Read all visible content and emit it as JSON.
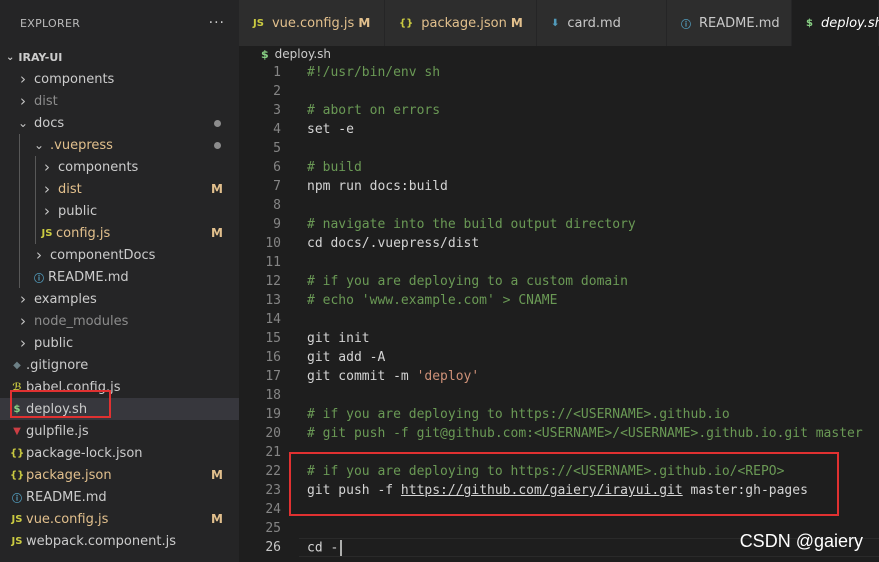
{
  "explorer": {
    "title": "EXPLORER",
    "more": "···",
    "root": "IRAY-UI",
    "items": [
      {
        "label": "components",
        "depth": 0,
        "type": "folder",
        "state": "collapsed"
      },
      {
        "label": "dist",
        "depth": 0,
        "type": "folder",
        "state": "collapsed",
        "dim": true
      },
      {
        "label": "docs",
        "depth": 0,
        "type": "folder",
        "state": "expanded",
        "dot": true
      },
      {
        "label": ".vuepress",
        "depth": 1,
        "type": "folder",
        "state": "expanded",
        "dot": true,
        "color": "#e2c08d"
      },
      {
        "label": "components",
        "depth": 2,
        "type": "folder",
        "state": "collapsed"
      },
      {
        "label": "dist",
        "depth": 2,
        "type": "folder",
        "state": "collapsed",
        "badge": "M",
        "color": "#e2c08d"
      },
      {
        "label": "public",
        "depth": 2,
        "type": "folder",
        "state": "collapsed"
      },
      {
        "label": "config.js",
        "depth": 2,
        "type": "file",
        "icon": "JS",
        "iconColor": "#cbcb41",
        "badge": "M",
        "color": "#e2c08d"
      },
      {
        "label": "componentDocs",
        "depth": 1,
        "type": "folder",
        "state": "collapsed"
      },
      {
        "label": "README.md",
        "depth": 1,
        "type": "file",
        "icon": "ⓘ",
        "iconColor": "#519aba"
      },
      {
        "label": "examples",
        "depth": 0,
        "type": "folder",
        "state": "collapsed"
      },
      {
        "label": "node_modules",
        "depth": 0,
        "type": "folder",
        "state": "collapsed",
        "dim": true
      },
      {
        "label": "public",
        "depth": 0,
        "type": "folder",
        "state": "collapsed"
      },
      {
        "label": ".gitignore",
        "depth": 0,
        "type": "file",
        "icon": "◆",
        "iconColor": "#6d8086"
      },
      {
        "label": "babel.config.js",
        "depth": 0,
        "type": "file",
        "icon": "ℬ",
        "iconColor": "#cbcb41"
      },
      {
        "label": "deploy.sh",
        "depth": 0,
        "type": "file",
        "icon": "$",
        "iconColor": "#89d185",
        "selected": true
      },
      {
        "label": "gulpfile.js",
        "depth": 0,
        "type": "file",
        "icon": "▼",
        "iconColor": "#cc3e44"
      },
      {
        "label": "package-lock.json",
        "depth": 0,
        "type": "file",
        "icon": "{}",
        "iconColor": "#cbcb41"
      },
      {
        "label": "package.json",
        "depth": 0,
        "type": "file",
        "icon": "{}",
        "iconColor": "#cbcb41",
        "badge": "M",
        "color": "#e2c08d"
      },
      {
        "label": "README.md",
        "depth": 0,
        "type": "file",
        "icon": "ⓘ",
        "iconColor": "#519aba"
      },
      {
        "label": "vue.config.js",
        "depth": 0,
        "type": "file",
        "icon": "JS",
        "iconColor": "#cbcb41",
        "badge": "M",
        "color": "#e2c08d"
      },
      {
        "label": "webpack.component.js",
        "depth": 0,
        "type": "file",
        "icon": "JS",
        "iconColor": "#cbcb41"
      }
    ]
  },
  "tabs": [
    {
      "label": "vue.config.js",
      "icon": "JS",
      "iconColor": "#cbcb41",
      "badge": "M",
      "color": "#e2c08d"
    },
    {
      "label": "package.json",
      "icon": "{}",
      "iconColor": "#cbcb41",
      "badge": "M",
      "color": "#e2c08d"
    },
    {
      "label": "card.md",
      "icon": "⬇",
      "iconColor": "#519aba"
    },
    {
      "label": "README.md",
      "icon": "ⓘ",
      "iconColor": "#519aba"
    },
    {
      "label": "deploy.sh",
      "icon": "$",
      "iconColor": "#89d185",
      "active": true
    }
  ],
  "breadcrumb": {
    "icon": "$",
    "file": "deploy.sh"
  },
  "editor": {
    "lines": [
      {
        "n": "1",
        "tokens": [
          {
            "t": "#!/usr/bin/env sh",
            "c": "cm"
          }
        ]
      },
      {
        "n": "2",
        "tokens": []
      },
      {
        "n": "3",
        "tokens": [
          {
            "t": "# abort on errors",
            "c": "cm"
          }
        ]
      },
      {
        "n": "4",
        "tokens": [
          {
            "t": "set -e"
          }
        ]
      },
      {
        "n": "5",
        "tokens": []
      },
      {
        "n": "6",
        "tokens": [
          {
            "t": "# build",
            "c": "cm"
          }
        ]
      },
      {
        "n": "7",
        "tokens": [
          {
            "t": "npm run docs:build"
          }
        ]
      },
      {
        "n": "8",
        "tokens": []
      },
      {
        "n": "9",
        "tokens": [
          {
            "t": "# navigate into the build output directory",
            "c": "cm"
          }
        ]
      },
      {
        "n": "10",
        "tokens": [
          {
            "t": "cd docs/.vuepress/dist"
          }
        ]
      },
      {
        "n": "11",
        "tokens": []
      },
      {
        "n": "12",
        "tokens": [
          {
            "t": "# if you are deploying to a custom domain",
            "c": "cm"
          }
        ]
      },
      {
        "n": "13",
        "tokens": [
          {
            "t": "# echo 'www.example.com' > CNAME",
            "c": "cm"
          }
        ]
      },
      {
        "n": "14",
        "tokens": []
      },
      {
        "n": "15",
        "tokens": [
          {
            "t": "git init"
          }
        ]
      },
      {
        "n": "16",
        "tokens": [
          {
            "t": "git add -A"
          }
        ]
      },
      {
        "n": "17",
        "tokens": [
          {
            "t": "git commit -m "
          },
          {
            "t": "'deploy'",
            "c": "str"
          }
        ]
      },
      {
        "n": "18",
        "tokens": []
      },
      {
        "n": "19",
        "tokens": [
          {
            "t": "# if you are deploying to https://<USERNAME>.github.io",
            "c": "cm"
          }
        ]
      },
      {
        "n": "20",
        "tokens": [
          {
            "t": "# git push -f git@github.com:<USERNAME>/<USERNAME>.github.io.git master",
            "c": "cm"
          }
        ]
      },
      {
        "n": "21",
        "tokens": []
      },
      {
        "n": "22",
        "tokens": [
          {
            "t": "# if you are deploying to https://<USERNAME>.github.io/<REPO>",
            "c": "cm"
          }
        ]
      },
      {
        "n": "23",
        "tokens": [
          {
            "t": "git push -f "
          },
          {
            "t": "https://github.com/gaiery/irayui.git",
            "c": "url"
          },
          {
            "t": " master:gh-pages"
          }
        ]
      },
      {
        "n": "24",
        "tokens": []
      },
      {
        "n": "25",
        "tokens": []
      },
      {
        "n": "26",
        "tokens": [
          {
            "t": "cd -"
          }
        ],
        "current": true
      }
    ]
  },
  "watermark": "CSDN @gaiery"
}
